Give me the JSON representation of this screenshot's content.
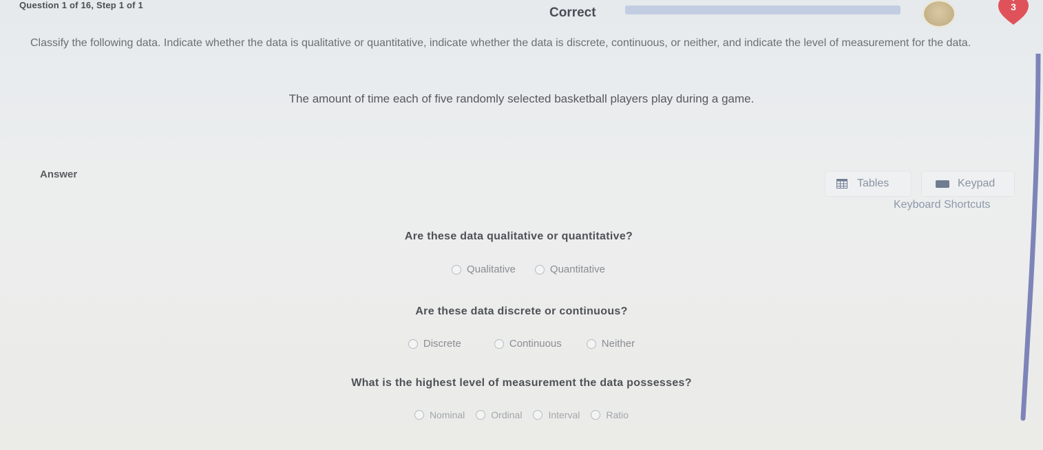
{
  "header": {
    "question_progress": "Question 1 of 16, Step 1 of 1",
    "status": "Correct",
    "progress_fraction": 1.0,
    "lives": "3",
    "colors": {
      "lives_badge": "#e0525a",
      "progress": "#c3cde2",
      "scrollbar": "#7d84b8"
    }
  },
  "instructions": "Classify the following data. Indicate whether the data is qualitative or quantitative, indicate whether the data is discrete, continuous, or neither, and indicate the level of measurement for the data.",
  "prompt": "The amount of time each of five randomly selected basketball players play during a game.",
  "answer": {
    "label": "Answer",
    "tables_label": "Tables",
    "keypad_label": "Keypad",
    "shortcuts_label": "Keyboard Shortcuts"
  },
  "questions": [
    {
      "text": "Are these data qualitative or quantitative?",
      "options": [
        "Qualitative",
        "Quantitative"
      ]
    },
    {
      "text": "Are these data discrete or continuous?",
      "options": [
        "Discrete",
        "Continuous",
        "Neither"
      ]
    },
    {
      "text": "What is the highest level of measurement the data possesses?",
      "options": [
        "Nominal",
        "Ordinal",
        "Interval",
        "Ratio"
      ]
    }
  ],
  "icons": [
    "avatar-icon",
    "heart-icon",
    "table-grid-icon",
    "keypad-icon",
    "radio-icon"
  ]
}
